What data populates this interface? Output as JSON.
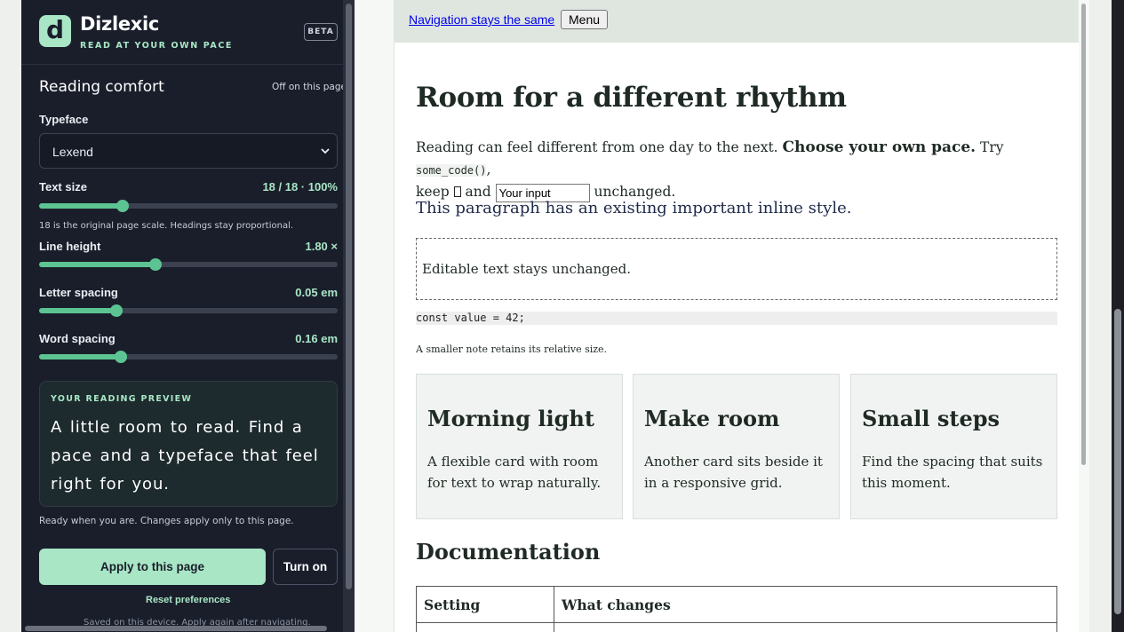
{
  "extension": {
    "logo_letter": "d",
    "name": "Dizlexic",
    "tagline": "READ AT YOUR OWN PACE",
    "badge": "BETA",
    "section_title": "Reading comfort",
    "page_status": "Off on this page",
    "typeface": {
      "label": "Typeface",
      "selected": "Lexend"
    },
    "sliders": [
      {
        "label": "Text size",
        "value_text": "18 / 18 · 100%",
        "fraction": 0.28
      },
      {
        "label": "Line height",
        "value_text": "1.80 ×",
        "fraction": 0.39
      },
      {
        "label": "Letter spacing",
        "value_text": "0.05 em",
        "fraction": 0.26
      },
      {
        "label": "Word spacing",
        "value_text": "0.16 em",
        "fraction": 0.275
      }
    ],
    "text_size_hint": "18 is the original page scale. Headings stay proportional.",
    "preview_label": "YOUR READING PREVIEW",
    "preview_text": "A little room to read. Find a pace and a typeface that feel right for you.",
    "ready_note": "Ready when you are. Changes apply only to this page.",
    "apply_label": "Apply to this page",
    "turn_on_label": "Turn on",
    "reset_label": "Reset preferences",
    "saved_note": "Saved on this device. Apply again after navigating."
  },
  "page": {
    "nav_link": "Navigation stays the same",
    "menu_label": "Menu",
    "heading": "Room for a different rhythm",
    "intro": {
      "part1": "Reading can feel different from one day to the next. ",
      "bold": "Choose your own pace.",
      "part2": " Try ",
      "code": "some_code()",
      "part3": ",",
      "part4": "keep ",
      "part5": " and ",
      "input_value": "Your input",
      "part6": " unchanged."
    },
    "important_para": "This paragraph has an existing important inline style.",
    "editable_text": "Editable text stays unchanged.",
    "code_block": "const value = 42;",
    "small_note": "A smaller note retains its relative size.",
    "cards": [
      {
        "title": "Morning light",
        "body": "A flexible card with room for text to wrap naturally."
      },
      {
        "title": "Make room",
        "body": "Another card sits beside it in a responsive grid."
      },
      {
        "title": "Small steps",
        "body": "Find the spacing that suits this moment."
      }
    ],
    "docs_heading": "Documentation",
    "table_headers": [
      "Setting",
      "What changes"
    ]
  },
  "colors": {
    "panel_bg": "#1a1e2b",
    "accent": "#a8e6c5",
    "slider_fill": "#5cc492"
  }
}
